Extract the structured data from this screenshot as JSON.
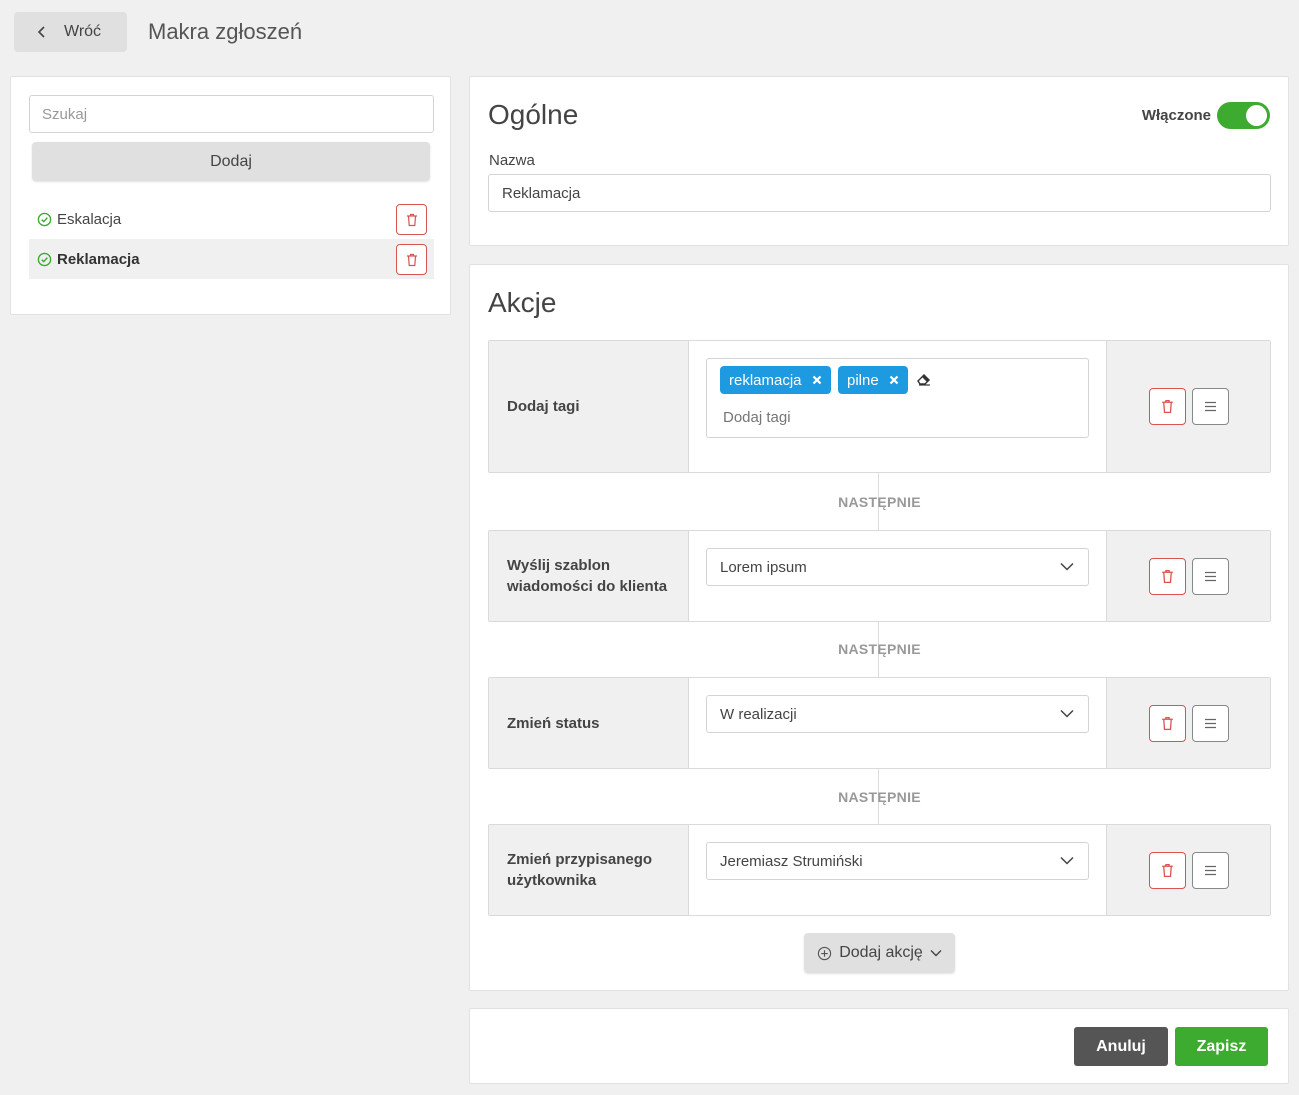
{
  "header": {
    "back_label": "Wróć",
    "title": "Makra zgłoszeń"
  },
  "sidebar": {
    "search_placeholder": "Szukaj",
    "add_label": "Dodaj",
    "items": [
      {
        "label": "Eskalacja",
        "active": false
      },
      {
        "label": "Reklamacja",
        "active": true
      }
    ]
  },
  "general": {
    "title": "Ogólne",
    "toggle_label": "Włączone",
    "toggle_on": true,
    "name_label": "Nazwa",
    "name_value": "Reklamacja"
  },
  "actions": {
    "title": "Akcje",
    "next_label": "NASTĘPNIE",
    "rows": [
      {
        "label": "Dodaj tagi",
        "tags": [
          "reklamacja",
          "pilne"
        ],
        "tag_placeholder": "Dodaj tagi"
      },
      {
        "label": "Wyślij szablon wiadomości do klienta",
        "value": "Lorem ipsum"
      },
      {
        "label": "Zmień status",
        "value": "W realizacji"
      },
      {
        "label": "Zmień przypisanego użytkownika",
        "value": "Jeremiasz Strumiński"
      }
    ],
    "add_action_label": "Dodaj akcję"
  },
  "footer": {
    "cancel_label": "Anuluj",
    "save_label": "Zapisz"
  },
  "colors": {
    "accent_green": "#3cab2f",
    "tag_blue": "#1e9ae0",
    "delete_red": "#d9534f",
    "cancel_gray": "#555555"
  }
}
